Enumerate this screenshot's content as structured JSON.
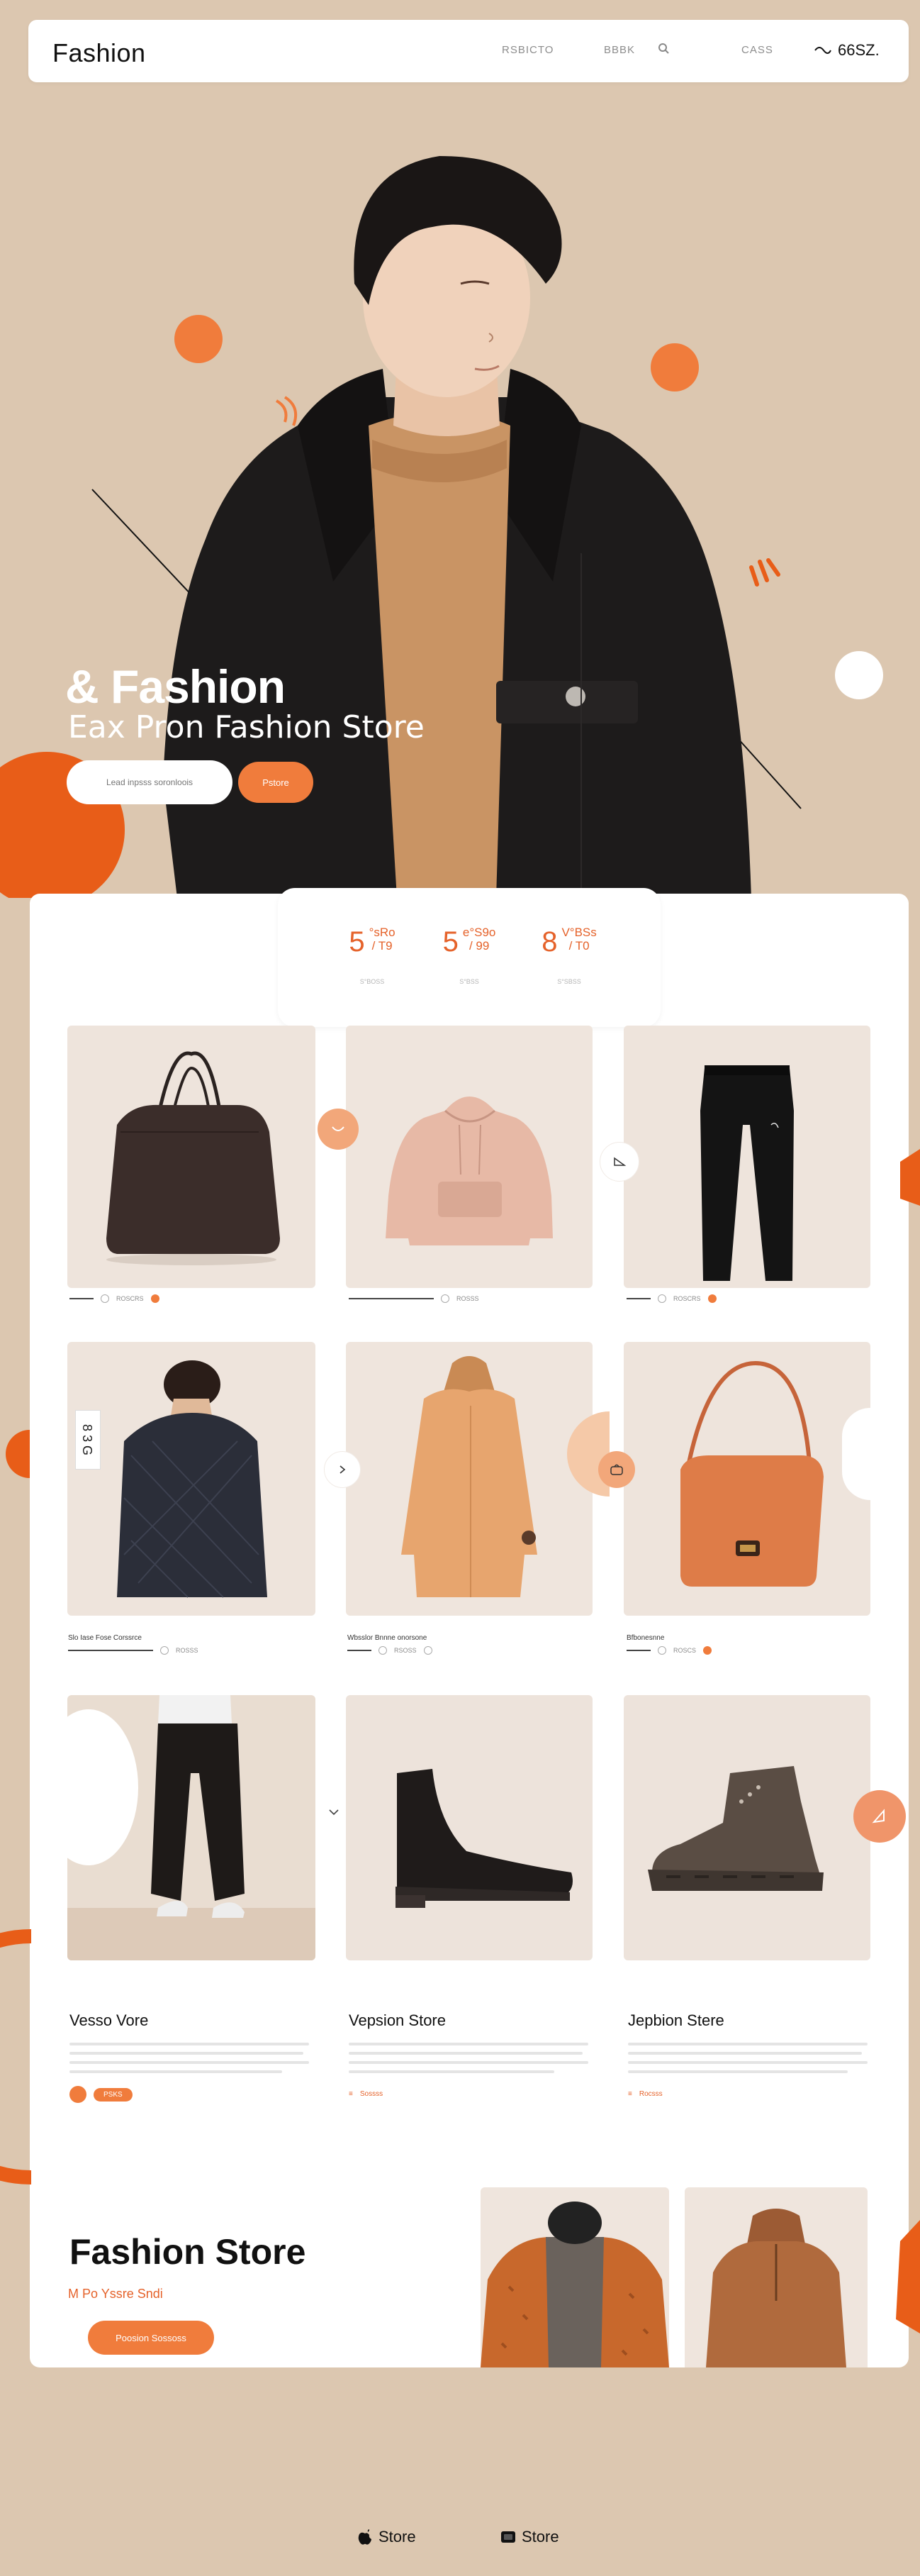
{
  "nav": {
    "brand": "Fashion",
    "link1": "RSBICTO",
    "link2": "BBBK",
    "link3": "CASS",
    "right_label": "66SZ."
  },
  "hero": {
    "title": "& Fashion",
    "subtitle": "Eax  Pron Fashion Store",
    "input_placeholder": "Lead inpsss soronloois",
    "button_label": "Pstore"
  },
  "stats": [
    {
      "value": "5",
      "detail_top": "°sRo",
      "detail_bottom": "/ T9",
      "label": "S°BOSS"
    },
    {
      "value": "5",
      "detail_top": "e°S9o",
      "detail_bottom": "/ 99",
      "label": "S°BSS"
    },
    {
      "value": "8",
      "detail_top": "V°BSs",
      "detail_bottom": "/ T0",
      "label": "S°SBSS"
    }
  ],
  "products_row1": [
    {
      "name": "bag-tile",
      "meta": "ROSCRS"
    },
    {
      "name": "hoodie-tile",
      "meta": "ROSSS"
    },
    {
      "name": "pants-tile",
      "meta": "ROSCRS"
    }
  ],
  "products_row2": [
    {
      "name": "jacket-tile",
      "caption": "Slo Iase Fose Corssrce",
      "meta": "ROSSS"
    },
    {
      "name": "coat-tile",
      "caption": "Wbsslor Bnnne onorsone",
      "meta": "RSOSS"
    },
    {
      "name": "handbag-tile",
      "caption": "Bfbonesnne",
      "meta": "ROSCS"
    }
  ],
  "side_label": "8 3 G",
  "stores": [
    {
      "title": "Vesso Vore",
      "foot": "PSKS"
    },
    {
      "title": "Vepsion Store",
      "foot": "Sossss"
    },
    {
      "title": "Jepbion Stere",
      "foot": "Rocsss"
    }
  ],
  "promo": {
    "title": "Fashion Store",
    "subtitle": "M Po Yssre Sndi",
    "button_label": "Poosion Sossoss"
  },
  "footer": {
    "link1": "Store",
    "link2": "Store"
  },
  "colors": {
    "background": "#dcc7b0",
    "accent": "#f07c3c",
    "accent_dark": "#e5622a",
    "card": "#ffffff"
  }
}
